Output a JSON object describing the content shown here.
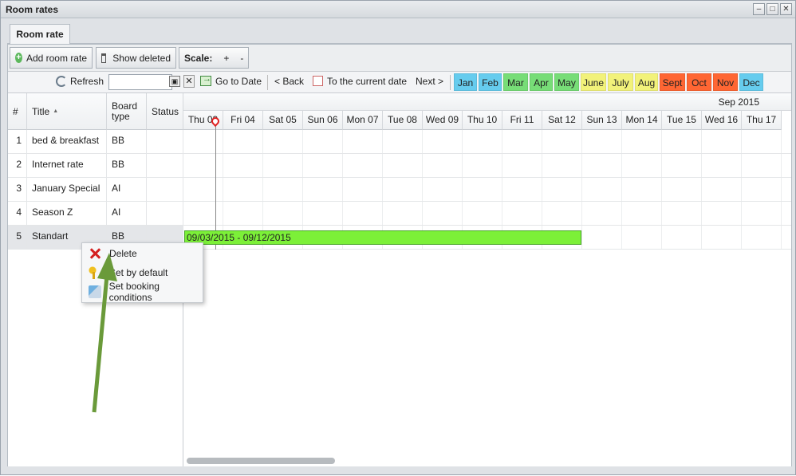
{
  "window": {
    "title": "Room rates"
  },
  "tabs": [
    {
      "label": "Room rate"
    }
  ],
  "toolbar": {
    "add_label": "Add room rate",
    "show_deleted_label": "Show deleted",
    "scale_label": "Scale:",
    "scale_plus": "+",
    "scale_minus": "-"
  },
  "nav": {
    "refresh_label": "Refresh",
    "goto_label": "Go to Date",
    "back_label": "< Back",
    "current_label": "To the current date",
    "next_label": "Next >",
    "months": [
      {
        "label": "Jan",
        "color": "#66ccee"
      },
      {
        "label": "Feb",
        "color": "#66ccee"
      },
      {
        "label": "Mar",
        "color": "#77dd77"
      },
      {
        "label": "Apr",
        "color": "#77dd77"
      },
      {
        "label": "May",
        "color": "#77dd77"
      },
      {
        "label": "June",
        "color": "#f2f27a"
      },
      {
        "label": "July",
        "color": "#f2f27a"
      },
      {
        "label": "Aug",
        "color": "#f2f27a"
      },
      {
        "label": "Sept",
        "color": "#ff6633"
      },
      {
        "label": "Oct",
        "color": "#ff6633"
      },
      {
        "label": "Nov",
        "color": "#ff6633"
      },
      {
        "label": "Dec",
        "color": "#66ccee"
      }
    ]
  },
  "grid": {
    "headers": {
      "num": "#",
      "title": "Title",
      "sort_arrow": "▲",
      "board": "Board type",
      "status": "Status"
    },
    "rows": [
      {
        "num": "1",
        "title": "bed & breakfast",
        "board": "BB"
      },
      {
        "num": "2",
        "title": "Internet rate",
        "board": "BB"
      },
      {
        "num": "3",
        "title": "January Special",
        "board": "AI"
      },
      {
        "num": "4",
        "title": "Season Z",
        "board": "AI"
      },
      {
        "num": "5",
        "title": "Standart",
        "board": "BB"
      }
    ]
  },
  "timeline": {
    "month_label": "Sep 2015",
    "days": [
      "Thu 03",
      "Fri 04",
      "Sat 05",
      "Sun 06",
      "Mon 07",
      "Tue 08",
      "Wed 09",
      "Thu 10",
      "Fri 11",
      "Sat 12",
      "Sun 13",
      "Mon 14",
      "Tue 15",
      "Wed 16",
      "Thu 17"
    ],
    "bar_label": "09/03/2015 - 09/12/2015"
  },
  "context_menu": {
    "items": [
      {
        "label": "Delete",
        "icon": "delete-x-icon"
      },
      {
        "label": "Set by default",
        "icon": "key-icon"
      },
      {
        "label": "Set booking conditions",
        "icon": "brush-icon"
      }
    ]
  },
  "colors": {
    "bar": "#7cf038",
    "arrow": "#6a9a3a",
    "today_marker": "#e02020"
  }
}
